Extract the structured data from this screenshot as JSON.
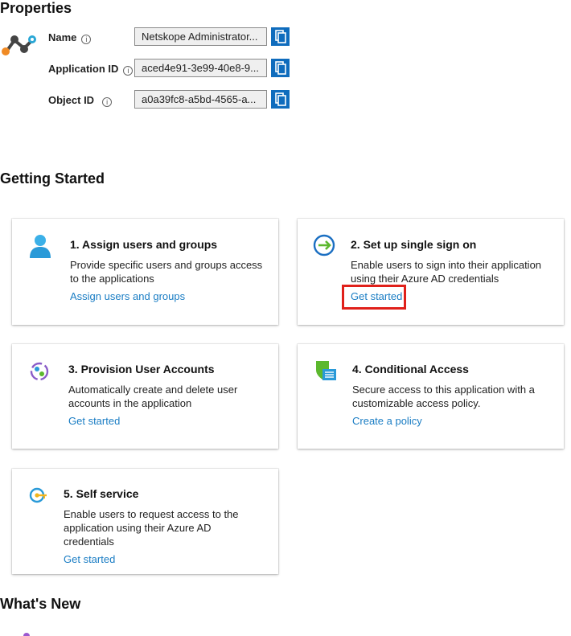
{
  "properties": {
    "title": "Properties",
    "fields": [
      {
        "label": "Name",
        "value": "Netskope Administrator..."
      },
      {
        "label": "Application ID",
        "value": "aced4e91-3e99-40e8-9..."
      },
      {
        "label": "Object ID",
        "value": "a0a39fc8-a5bd-4565-a..."
      }
    ],
    "info_icon": "i"
  },
  "getting_started": {
    "title": "Getting Started",
    "cards": [
      {
        "title": "1. Assign users and groups",
        "desc": "Provide specific users and groups access to the applications",
        "link": "Assign users and groups",
        "icon": "user-icon"
      },
      {
        "title": "2. Set up single sign on",
        "desc": "Enable users to sign into their application using their Azure AD credentials",
        "link": "Get started",
        "icon": "sign-in-arrow-icon"
      },
      {
        "title": "3. Provision User Accounts",
        "desc": "Automatically create and delete user accounts in the application",
        "link": "Get started",
        "icon": "provisioning-icon"
      },
      {
        "title": "4. Conditional Access",
        "desc": "Secure access to this application with a customizable access policy.",
        "link": "Create a policy",
        "icon": "shield-policy-icon"
      },
      {
        "title": "5. Self service",
        "desc": "Enable users to request access to the application using their Azure AD credentials",
        "link": "Get started",
        "icon": "self-service-key-icon"
      }
    ]
  },
  "whats_new": {
    "title": "What's New"
  },
  "colors": {
    "accent": "#0f6cbd",
    "link": "#1a7dc4",
    "highlight": "#e0201a"
  }
}
